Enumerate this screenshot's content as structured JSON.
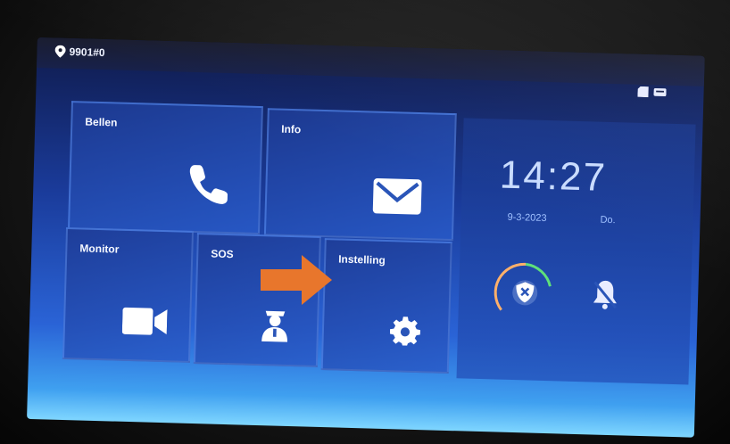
{
  "status_bar": {
    "location_label": "9901#0",
    "icons": [
      "location-pin-icon",
      "sd-card-icon",
      "memory-icon"
    ]
  },
  "tiles": {
    "bellen": {
      "label": "Bellen",
      "icon": "phone-icon"
    },
    "info": {
      "label": "Info",
      "icon": "envelope-icon"
    },
    "monitor": {
      "label": "Monitor",
      "icon": "video-camera-icon"
    },
    "sos": {
      "label": "SOS",
      "icon": "security-guard-icon"
    },
    "instelling": {
      "label": "Instelling",
      "icon": "gear-icon"
    }
  },
  "clock": {
    "time": "14:27",
    "date": "9-3-2023",
    "day": "Do."
  },
  "controls": {
    "arm": {
      "icon": "shield-x-icon"
    },
    "bell": {
      "icon": "bell-muted-icon"
    }
  },
  "annotation": {
    "icon": "orange-arrow-icon",
    "color": "#e8762c"
  }
}
